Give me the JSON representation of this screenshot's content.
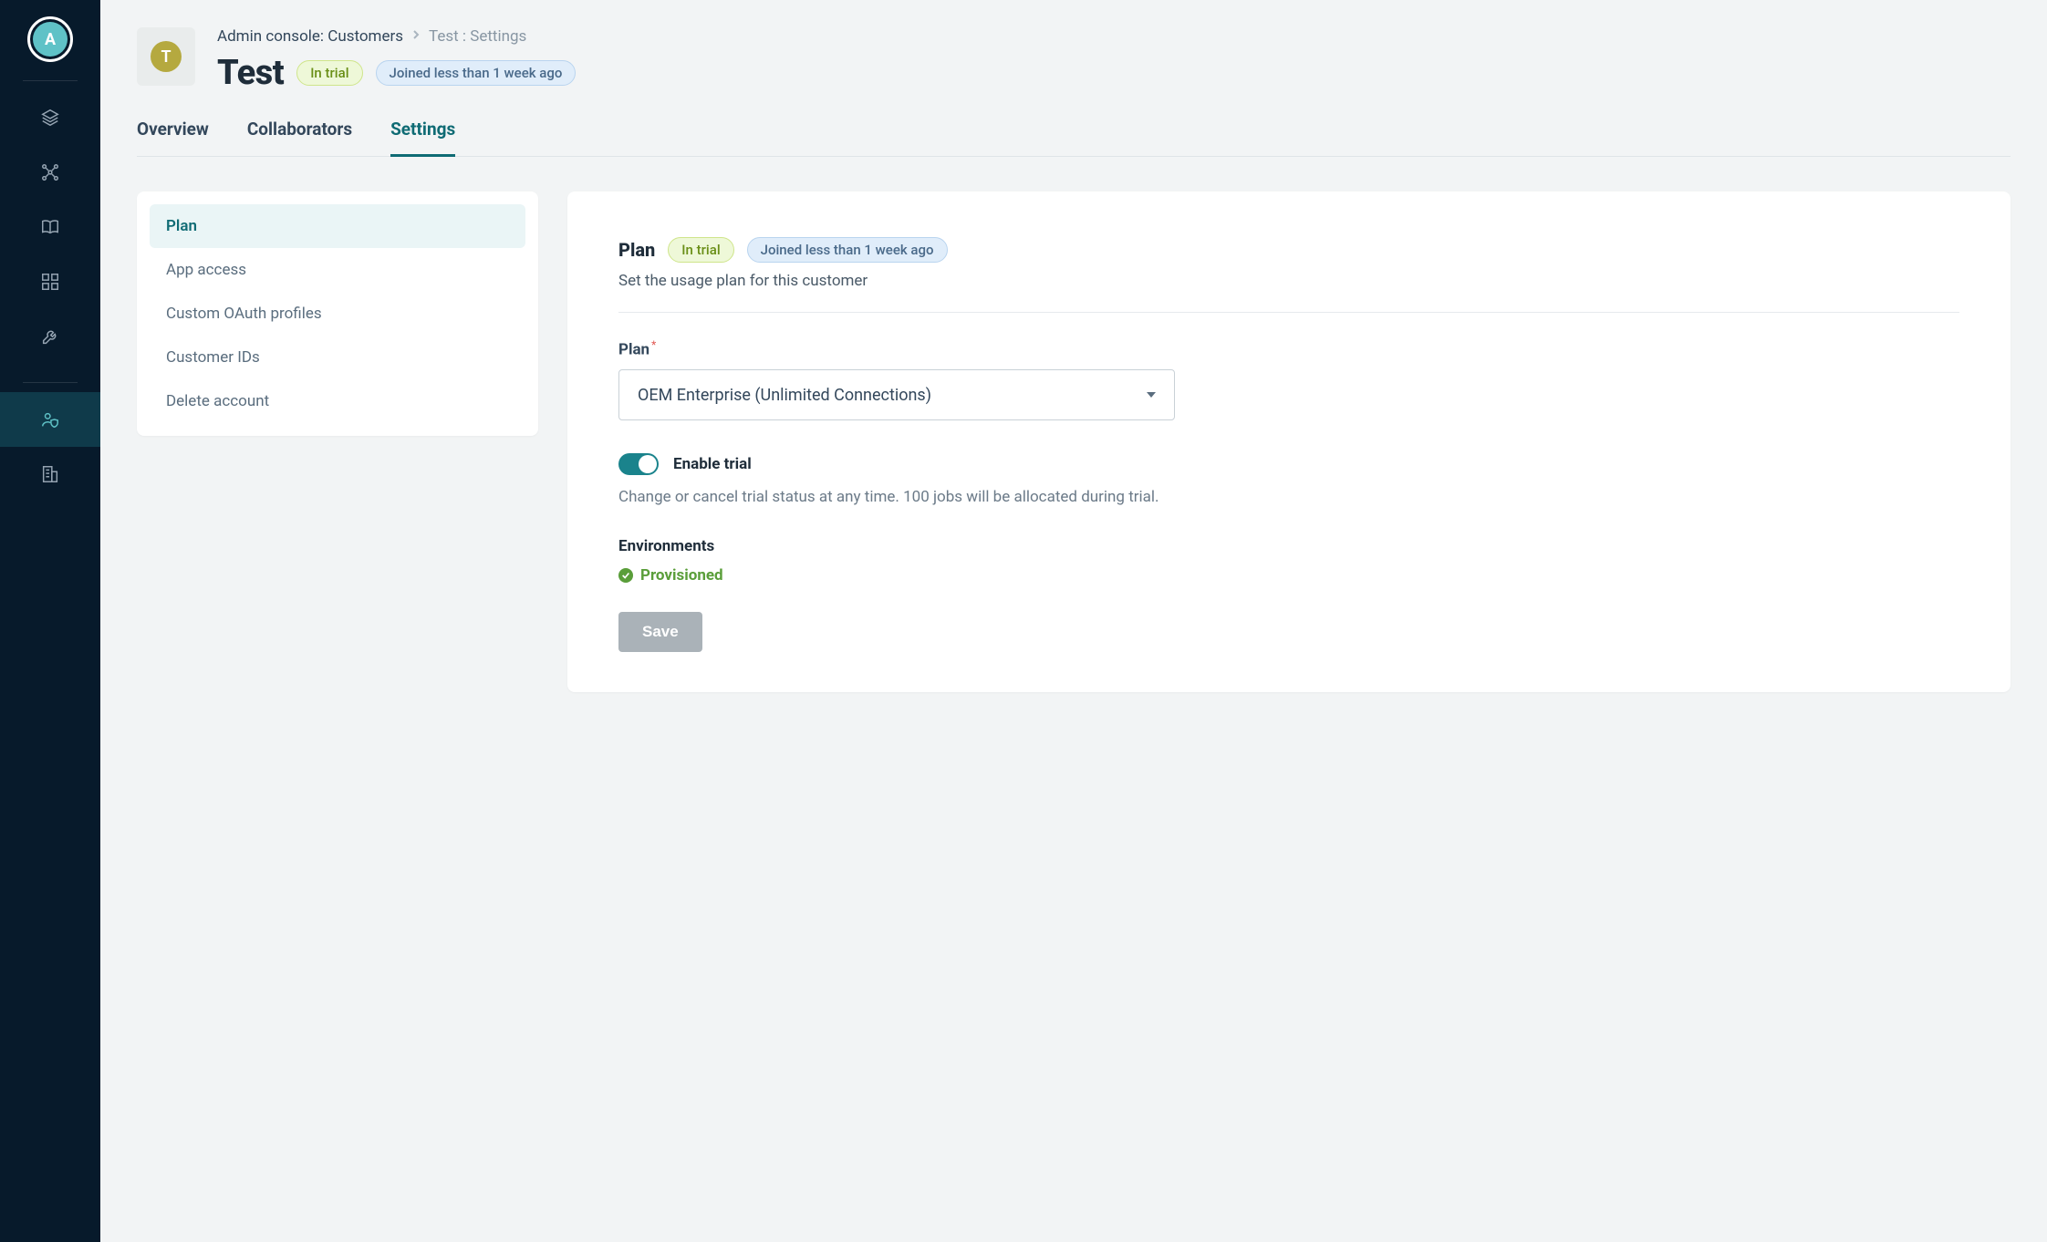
{
  "avatar": {
    "initial": "A"
  },
  "tile": {
    "initial": "T"
  },
  "breadcrumb": {
    "part1": "Admin console: Customers",
    "part2": "Test : Settings"
  },
  "page": {
    "title": "Test"
  },
  "badges": {
    "trial": "In trial",
    "joined": "Joined less than 1 week ago"
  },
  "tabs": [
    {
      "label": "Overview"
    },
    {
      "label": "Collaborators"
    },
    {
      "label": "Settings"
    }
  ],
  "sidenav": {
    "items": [
      {
        "label": "Plan"
      },
      {
        "label": "App access"
      },
      {
        "label": "Custom OAuth profiles"
      },
      {
        "label": "Customer IDs"
      },
      {
        "label": "Delete account"
      }
    ]
  },
  "plan_section": {
    "title": "Plan",
    "trial_badge": "In trial",
    "joined_badge": "Joined less than 1 week ago",
    "subtitle": "Set the usage plan for this customer",
    "field_label": "Plan",
    "selected": "OEM Enterprise (Unlimited Connections)",
    "toggle_label": "Enable trial",
    "toggle_help": "Change or cancel trial status at any time. 100 jobs will be allocated during trial.",
    "env_title": "Environments",
    "env_status": "Provisioned",
    "save_label": "Save"
  },
  "colors": {
    "accent": "#0f6b74",
    "nav_bg": "#071a2b",
    "trial_pill_bg": "#eef8d8",
    "joined_pill_bg": "#e0edfa",
    "success": "#5a9e3a"
  }
}
